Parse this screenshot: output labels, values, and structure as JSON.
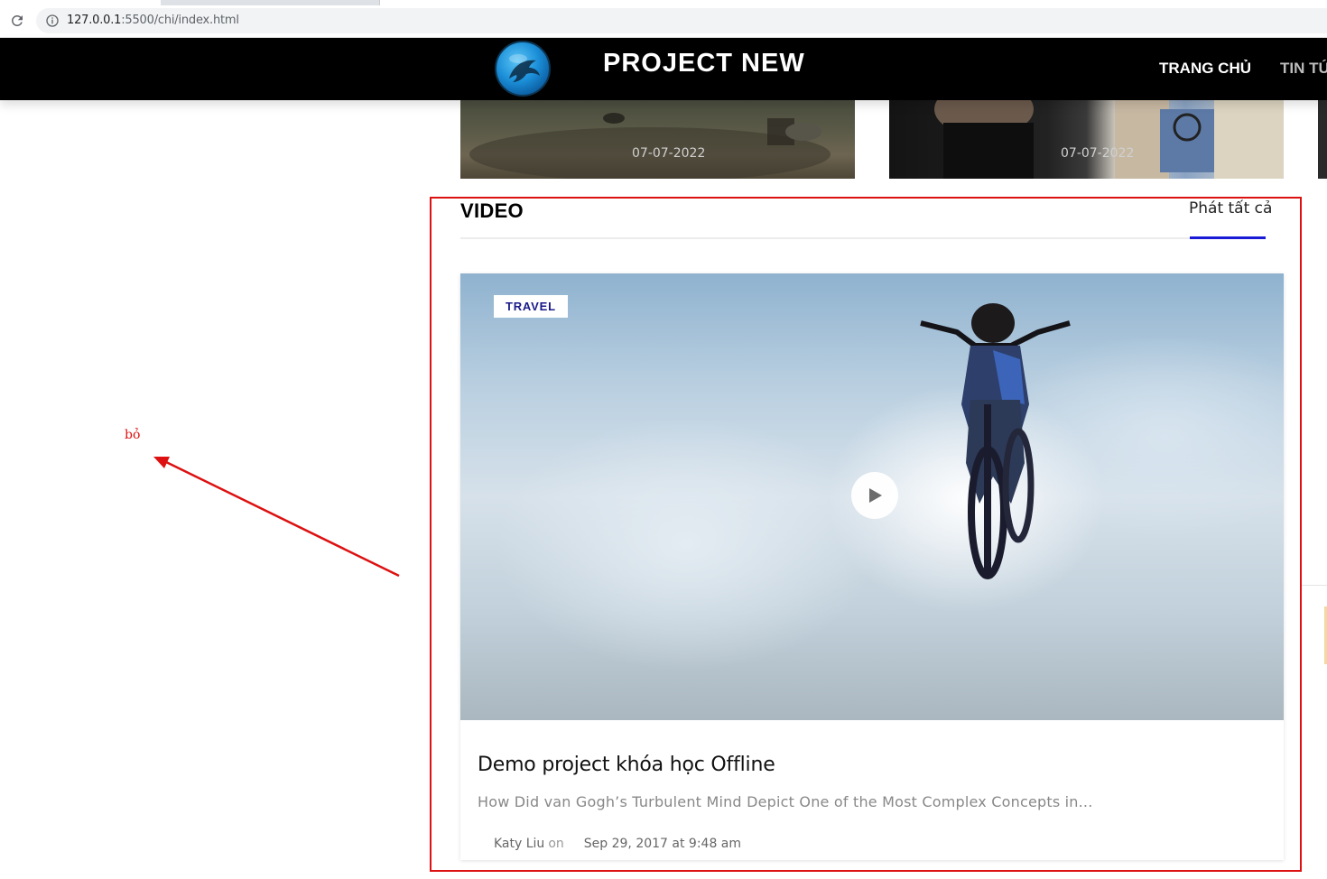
{
  "browser": {
    "url_host": "127.0.0.1",
    "url_rest": ":5500/chi/index.html"
  },
  "header": {
    "site_title": "PROJECT NEW",
    "nav": [
      {
        "label": "TRANG CHỦ"
      },
      {
        "label": "TIN TỨ"
      }
    ],
    "logo_icon": "dolphin-logo-icon"
  },
  "thumbnails": [
    {
      "date": "07-07-2022"
    },
    {
      "date": "07-07-2022"
    }
  ],
  "annotation": {
    "text": "bỏ",
    "color": "#dd1111"
  },
  "video_section": {
    "heading": "VIDEO",
    "play_all": "Phát tất cả",
    "accent_color": "#1a1ad6",
    "card": {
      "category": "TRAVEL",
      "title": "Demo project khóa học Offline",
      "excerpt": "How Did van Gogh’s Turbulent Mind Depict One of the Most Complex Concepts in...",
      "author": "Katy Liu",
      "on_text": "on",
      "date": "Sep 29, 2017 at 9:48 am"
    }
  }
}
